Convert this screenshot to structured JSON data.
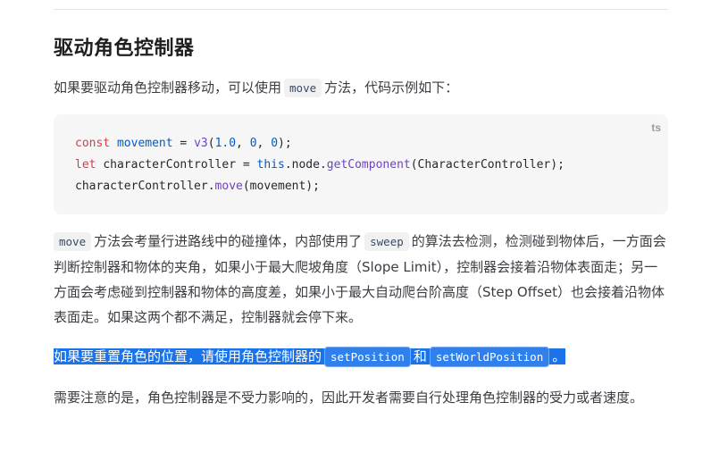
{
  "heading": "驱动角色控制器",
  "intro": {
    "before": "如果要驱动角色控制器移动，可以使用",
    "code": "move",
    "after": "方法，代码示例如下："
  },
  "code_block": {
    "lang": "ts",
    "lines": [
      {
        "kw": "const",
        "name": "movement",
        "rest_op": " = ",
        "fn": "v3",
        "args_open": "(",
        "n1": "1.0",
        "sep1": ", ",
        "n2": "0",
        "sep2": ", ",
        "n3": "0",
        "close": ");"
      },
      {
        "kw": "let",
        "name": "characterController",
        "rest_op": " = ",
        "this": "this",
        "chain": ".node.",
        "fn": "getComponent",
        "tail": "(CharacterController);"
      },
      {
        "obj": "characterController.",
        "fn": "move",
        "tail": "(movement);"
      }
    ]
  },
  "para2": {
    "code1": "move",
    "t1": "方法会考量行进路线中的碰撞体，内部使用了",
    "code2": "sweep",
    "t2": "的算法去检测，检测碰到物体后，一方面会判断控制器和物体的夹角，如果小于最大爬坡角度（Slope Limit），控制器会接着沿物体表面走；另一方面会考虑碰到控制器和物体的高度差，如果小于最大自动爬台阶高度（Step Offset）也会接着沿物体表面走。如果这两个都不满足，控制器就会停下来。"
  },
  "para3": {
    "t1": "如果要重置角色的位置，请使用角色控制器的",
    "code1": "setPosition",
    "t2": "和",
    "code2": "setWorldPosition",
    "t3": "。"
  },
  "para4": "需要注意的是，角色控制器是不受力影响的，因此开发者需要自行处理角色控制器的受力或者速度。",
  "colors": {
    "selection": "#1a73e8",
    "code_bg": "#f6f6f7",
    "keyword": "#d73a49",
    "identifier": "#005cc5",
    "function": "#6f42c1"
  }
}
